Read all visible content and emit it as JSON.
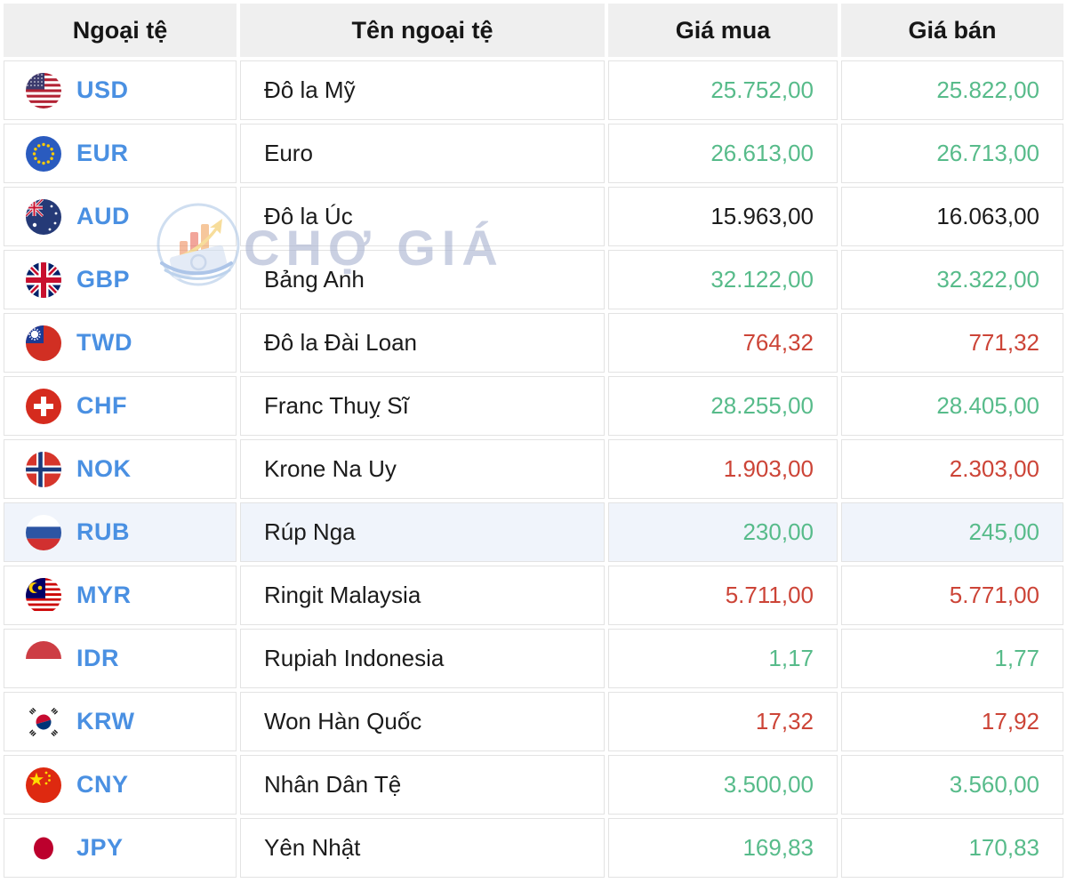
{
  "table": {
    "headers": [
      "Ngoại tệ",
      "Tên ngoại tệ",
      "Giá mua",
      "Giá bán"
    ],
    "rows": [
      {
        "code": "USD",
        "icon": "usd-flag-icon",
        "name": "Đô la Mỹ",
        "buy": "25.752,00",
        "sell": "25.822,00",
        "trend": "green",
        "highlighted": false
      },
      {
        "code": "EUR",
        "icon": "eur-flag-icon",
        "name": "Euro",
        "buy": "26.613,00",
        "sell": "26.713,00",
        "trend": "green",
        "highlighted": false
      },
      {
        "code": "AUD",
        "icon": "aud-flag-icon",
        "name": "Đô la Úc",
        "buy": "15.963,00",
        "sell": "16.063,00",
        "trend": "neutral",
        "highlighted": false
      },
      {
        "code": "GBP",
        "icon": "gbp-flag-icon",
        "name": "Bảng Anh",
        "buy": "32.122,00",
        "sell": "32.322,00",
        "trend": "green",
        "highlighted": false
      },
      {
        "code": "TWD",
        "icon": "twd-flag-icon",
        "name": "Đô la Đài Loan",
        "buy": "764,32",
        "sell": "771,32",
        "trend": "red",
        "highlighted": false
      },
      {
        "code": "CHF",
        "icon": "chf-flag-icon",
        "name": "Franc Thuỵ Sĩ",
        "buy": "28.255,00",
        "sell": "28.405,00",
        "trend": "green",
        "highlighted": false
      },
      {
        "code": "NOK",
        "icon": "nok-flag-icon",
        "name": "Krone Na Uy",
        "buy": "1.903,00",
        "sell": "2.303,00",
        "trend": "red",
        "highlighted": false
      },
      {
        "code": "RUB",
        "icon": "rub-flag-icon",
        "name": "Rúp Nga",
        "buy": "230,00",
        "sell": "245,00",
        "trend": "green",
        "highlighted": true
      },
      {
        "code": "MYR",
        "icon": "myr-flag-icon",
        "name": "Ringit Malaysia",
        "buy": "5.711,00",
        "sell": "5.771,00",
        "trend": "red",
        "highlighted": false
      },
      {
        "code": "IDR",
        "icon": "idr-flag-icon",
        "name": "Rupiah Indonesia",
        "buy": "1,17",
        "sell": "1,77",
        "trend": "green",
        "highlighted": false
      },
      {
        "code": "KRW",
        "icon": "krw-flag-icon",
        "name": "Won Hàn Quốc",
        "buy": "17,32",
        "sell": "17,92",
        "trend": "red",
        "highlighted": false
      },
      {
        "code": "CNY",
        "icon": "cny-flag-icon",
        "name": "Nhân Dân Tệ",
        "buy": "3.500,00",
        "sell": "3.560,00",
        "trend": "green",
        "highlighted": false
      },
      {
        "code": "JPY",
        "icon": "jpy-flag-icon",
        "name": "Yên Nhật",
        "buy": "169,83",
        "sell": "170,83",
        "trend": "green",
        "highlighted": false
      }
    ]
  },
  "watermark": {
    "text": "CHỢ GIÁ",
    "logo": "cho-gia-logo-icon"
  },
  "colors": {
    "price_up": "#57bb8a",
    "price_down": "#cc4437",
    "price_neutral": "#1c1c1c",
    "code_blue": "#4a90e2",
    "header_bg": "#efefef",
    "row_highlight": "#f0f4fb",
    "border": "#e3e3e3"
  }
}
